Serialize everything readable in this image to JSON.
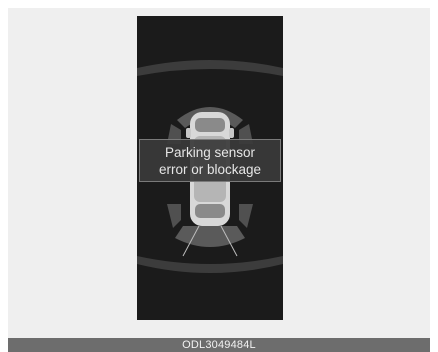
{
  "display": {
    "message_line1": "Parking sensor",
    "message_line2": "error or blockage"
  },
  "caption": {
    "code": "ODL3049484L"
  },
  "icons": [
    "car-top-view-icon",
    "front-sensor-zone-icon",
    "rear-sensor-zone-icon"
  ],
  "colors": {
    "screen_bg": "#1b1b1b",
    "sensor_zone": "#5a5a5a",
    "car_body": "#d8d8d8",
    "caption_bg": "#6d6d6d"
  }
}
